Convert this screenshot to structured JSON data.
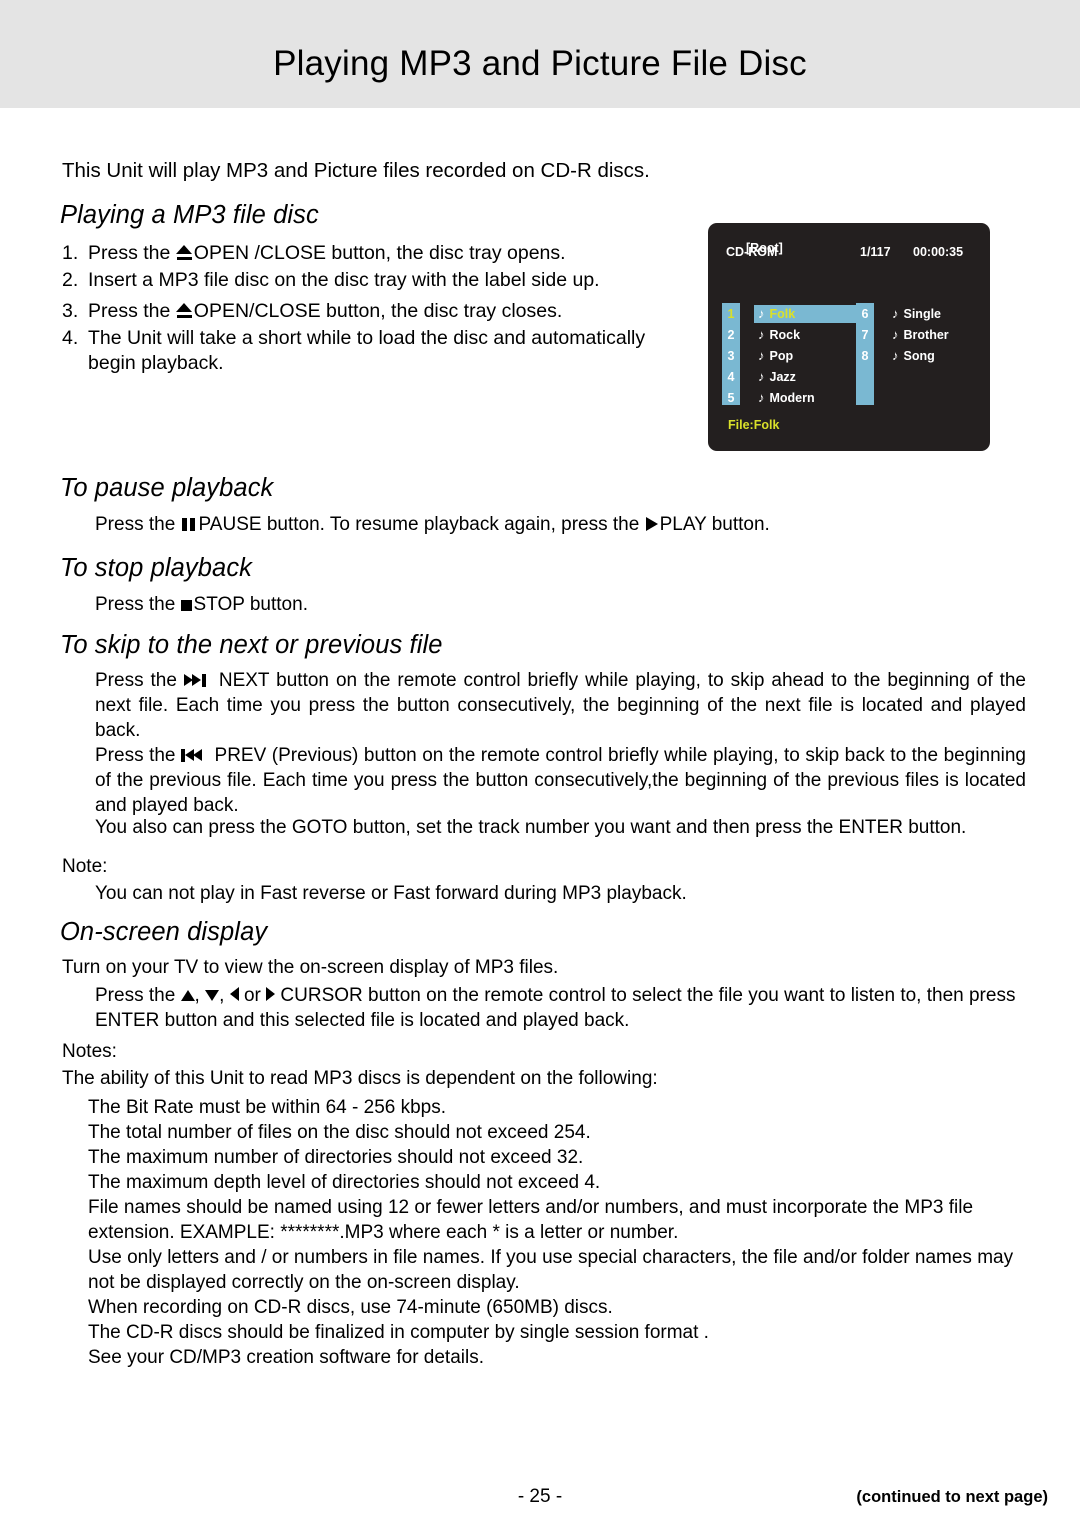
{
  "header": {
    "title": "Playing MP3 and Picture File Disc"
  },
  "intro": "This Unit will play MP3 and Picture files recorded on CD-R discs.",
  "sections": {
    "playing_heading": "Playing a MP3 file disc",
    "pause_heading": "To pause playback",
    "stop_heading": "To stop playback",
    "skip_heading": "To skip to the next or previous file",
    "osd_heading": "On-screen display"
  },
  "steps": [
    {
      "num": "1.",
      "pre": "Press the ",
      "icon": "eject-icon",
      "post": "OPEN /CLOSE button, the disc tray opens."
    },
    {
      "num": "2.",
      "pre": "Insert a MP3 file disc on the disc tray with the label side up.",
      "icon": "",
      "post": ""
    },
    {
      "num": "3.",
      "pre": "Press the ",
      "icon": "eject-icon",
      "post": "OPEN/CLOSE button, the disc tray closes."
    },
    {
      "num": "4.",
      "pre": "The Unit will take a short while to load the disc and automatically begin playback.",
      "icon": "",
      "post": ""
    }
  ],
  "pause_text": {
    "a": "Press the ",
    "b": "PAUSE button. To resume playback again, press the ",
    "c": "PLAY  button."
  },
  "stop_text": {
    "a": "Press the ",
    "b": "STOP button."
  },
  "skip_text": {
    "next_a": "Press the ",
    "next_b": " NEXT button on the remote control briefly while playing, to skip ahead to the beginning of the next file. Each time you press the button consecutively, the beginning of the next file is located and played back.",
    "prev_a": "Press  the ",
    "prev_b": "  PREV (Previous) button on the remote control briefly while playing, to skip back to the beginning of the previous file. Each time you press the button consecutively,the beginning of the previous files is located and played back.",
    "goto": "You also can press the GOTO button, set the track number you want and then press the ENTER button."
  },
  "note": {
    "label": "Note:",
    "body": "You can not play in Fast reverse or Fast forward during MP3 playback."
  },
  "osd_text": {
    "line1": "Turn on your TV to view the on-screen display of MP3 files.",
    "cursor_a": "Press the ",
    "cursor_sep1": ", ",
    "cursor_sep2": ", ",
    "cursor_sep3": " or ",
    "cursor_b": " CURSOR button on the remote control to select the file you want to listen to,  then press ENTER button and this selected file is located and played back."
  },
  "notes": {
    "label": "Notes:",
    "lead": "The ability of this Unit to read MP3 discs is dependent on the following:",
    "items": [
      "The Bit Rate must be within 64 - 256 kbps.",
      "The total number of files on the disc should not exceed 254.",
      "The maximum number of directories should not exceed 32.",
      "The maximum depth level of directories should not exceed 4.",
      "File names should be named using 12 or fewer letters and/or numbers, and must incorporate the  MP3  file extension. EXAMPLE: ********.MP3 where each * is a letter or number.",
      "Use only letters and / or numbers in file names. If you use special characters, the file and/or folder names may not be displayed correctly on the on-screen display.",
      "When recording on CD-R discs, use 74-minute (650MB) discs.",
      "The CD-R discs should be  finalized  in computer by  single session format .",
      "See your CD/MP3 creation software for details."
    ]
  },
  "osd": {
    "source": "CD-ROM",
    "track": "1/117",
    "time": "00:00:35",
    "root": "[Root]",
    "column1": [
      {
        "idx": "1",
        "name": "Folk",
        "selected": true
      },
      {
        "idx": "2",
        "name": "Rock",
        "selected": false
      },
      {
        "idx": "3",
        "name": "Pop",
        "selected": false
      },
      {
        "idx": "4",
        "name": "Jazz",
        "selected": false
      },
      {
        "idx": "5",
        "name": "Modern",
        "selected": false
      }
    ],
    "column2": [
      {
        "idx": "6",
        "name": "Single",
        "selected": false
      },
      {
        "idx": "7",
        "name": "Brother",
        "selected": false
      },
      {
        "idx": "8",
        "name": "Song",
        "selected": false
      }
    ],
    "file_label": "File:Folk",
    "colors": {
      "background": "#231f1f",
      "accent": "#7ab8d2",
      "highlight_text": "#d9e02a"
    }
  },
  "footer": {
    "page_number": "- 25 -",
    "continued": "(continued to next page)"
  }
}
